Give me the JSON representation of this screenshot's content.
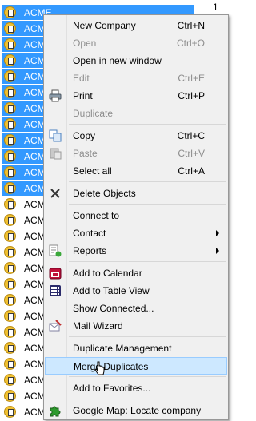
{
  "list": {
    "row_label": "ACME",
    "corner_label": "1",
    "row_count": 26,
    "selected_count": 12
  },
  "menu": {
    "items": [
      {
        "label": "New Company",
        "shortcut": "Ctrl+N",
        "enabled": true
      },
      {
        "label": "Open",
        "shortcut": "Ctrl+O",
        "enabled": false
      },
      {
        "label": "Open in new window",
        "shortcut": "",
        "enabled": true
      },
      {
        "label": "Edit",
        "shortcut": "Ctrl+E",
        "enabled": false
      },
      {
        "label": "Print",
        "shortcut": "Ctrl+P",
        "enabled": true,
        "icon": "printer-icon"
      },
      {
        "label": "Duplicate",
        "shortcut": "",
        "enabled": false
      },
      {
        "label": "Copy",
        "shortcut": "Ctrl+C",
        "enabled": true,
        "icon": "copy-icon"
      },
      {
        "label": "Paste",
        "shortcut": "Ctrl+V",
        "enabled": false,
        "icon": "paste-icon"
      },
      {
        "label": "Select all",
        "shortcut": "Ctrl+A",
        "enabled": true
      },
      {
        "label": "Delete Objects",
        "shortcut": "",
        "enabled": true,
        "icon": "delete-x-icon"
      },
      {
        "label": "Connect to",
        "shortcut": "",
        "enabled": true
      },
      {
        "label": "Contact",
        "shortcut": "",
        "enabled": true,
        "submenu": true
      },
      {
        "label": "Reports",
        "shortcut": "",
        "enabled": true,
        "submenu": true,
        "icon": "reports-icon"
      },
      {
        "label": "Add to Calendar",
        "shortcut": "",
        "enabled": true,
        "icon": "calendar-icon"
      },
      {
        "label": "Add to Table View",
        "shortcut": "",
        "enabled": true,
        "icon": "table-view-icon"
      },
      {
        "label": "Show Connected...",
        "shortcut": "",
        "enabled": true
      },
      {
        "label": "Mail Wizard",
        "shortcut": "",
        "enabled": true,
        "icon": "mail-wizard-icon"
      },
      {
        "label": "Duplicate Management",
        "shortcut": "",
        "enabled": true
      },
      {
        "label": "Merge Duplicates",
        "shortcut": "",
        "enabled": true,
        "highlighted": true
      },
      {
        "label": "Add to Favorites...",
        "shortcut": "",
        "enabled": true
      },
      {
        "label": "Google Map: Locate company",
        "shortcut": "",
        "enabled": true,
        "icon": "puzzle-icon"
      }
    ]
  },
  "colors": {
    "selection": "#3399ff",
    "menu_bg": "#f0f0f0",
    "highlight_bg": "#cde8ff",
    "disabled_text": "#8d8d8d"
  }
}
